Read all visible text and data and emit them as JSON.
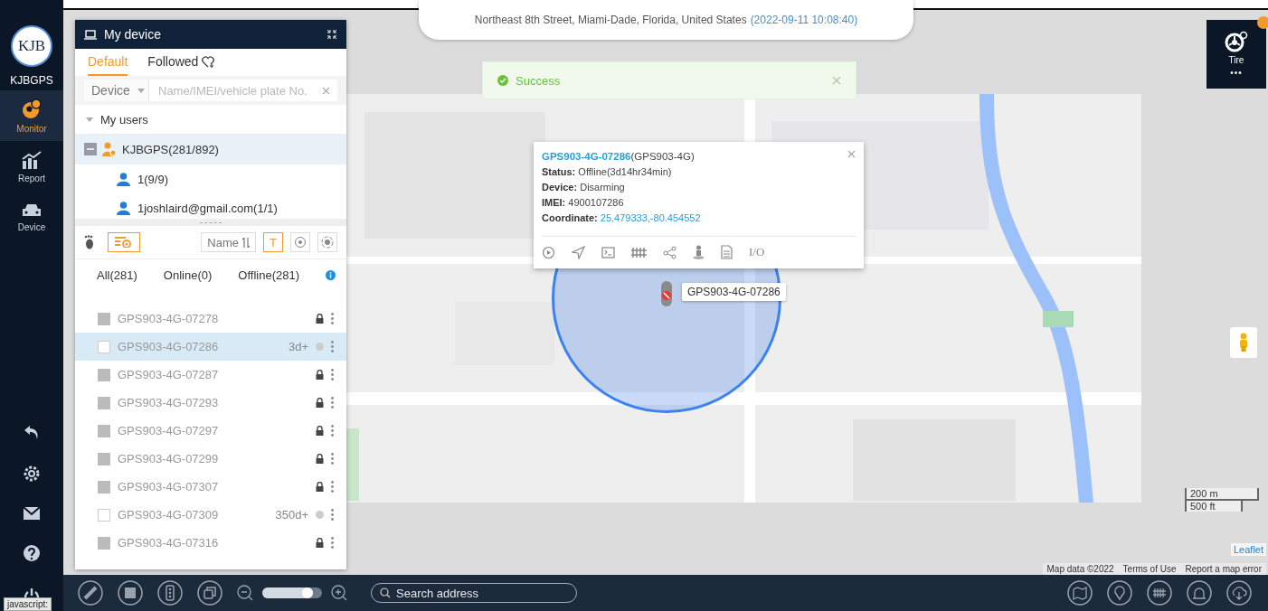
{
  "sidebar": {
    "logo": "KJB",
    "brand": "KJBGPS",
    "items": [
      {
        "label": "Monitor",
        "selected": true
      },
      {
        "label": "Report",
        "selected": false
      },
      {
        "label": "Device",
        "selected": false
      }
    ]
  },
  "device_panel": {
    "title": "My device",
    "tabs": [
      {
        "label": "Default",
        "selected": true
      },
      {
        "label": "Followed",
        "selected": false
      }
    ],
    "search": {
      "type": "Device",
      "placeholder": "Name/IMEI/vehicle plate No."
    },
    "tree": [
      {
        "label": "My users",
        "expanded": true,
        "children": [
          {
            "label": "KJBGPS(281/892)",
            "expanded": true,
            "selected": true,
            "children": [
              {
                "label": "1(9/9)",
                "selected": false
              },
              {
                "label": "1joshlaird@gmail.com(1/1)",
                "selected": false
              }
            ]
          }
        ]
      }
    ],
    "sort_label": "Name",
    "text_toggle": "T",
    "filters": [
      {
        "label": "All(281)"
      },
      {
        "label": "Online(0)"
      },
      {
        "label": "Offline(281)"
      }
    ],
    "devices": [
      {
        "name": "GPS903-4G-07278",
        "kind": "locked",
        "selected": false
      },
      {
        "name": "GPS903-4G-07286",
        "kind": "timed",
        "badge": "3d+",
        "selected": true
      },
      {
        "name": "GPS903-4G-07287",
        "kind": "locked",
        "selected": false
      },
      {
        "name": "GPS903-4G-07293",
        "kind": "locked",
        "selected": false
      },
      {
        "name": "GPS903-4G-07297",
        "kind": "locked",
        "selected": false
      },
      {
        "name": "GPS903-4G-07299",
        "kind": "locked",
        "selected": false
      },
      {
        "name": "GPS903-4G-07307",
        "kind": "locked",
        "selected": false
      },
      {
        "name": "GPS903-4G-07309",
        "kind": "timed",
        "badge": "350d+",
        "selected": false
      },
      {
        "name": "GPS903-4G-07316",
        "kind": "locked",
        "selected": false
      }
    ]
  },
  "address_bar": {
    "address": "Northeast 8th Street, Miami-Dade, Florida, United States",
    "time": "(2022-09-11 10:08:40)"
  },
  "toast": {
    "message": "Success"
  },
  "popup": {
    "device": "GPS903-4G-07286",
    "model": "(GPS903-4G)",
    "fields": [
      {
        "label": "Status:",
        "value": "Offline(3d14hr34min)",
        "link": false
      },
      {
        "label": "Device:",
        "value": "Disarming",
        "link": false
      },
      {
        "label": "IMEI:",
        "value": "4900107286",
        "link": false
      },
      {
        "label": "Coordinate:",
        "value": "25.479333,-80.454552",
        "link": true
      }
    ],
    "io_label": "I/O"
  },
  "marker_label": "GPS903-4G-07286",
  "tire_widget": {
    "label": "Tire",
    "more": "•••"
  },
  "scale": [
    "200 m",
    "500 ft"
  ],
  "leaflet": "Leaflet",
  "map_footer": [
    "Map data ©2022",
    "Terms of Use",
    "Report a map error"
  ],
  "toolbar": {
    "zoom_slider": {
      "level": 0.85
    },
    "search_placeholder": "Search address"
  },
  "status_text": "javascript:"
}
